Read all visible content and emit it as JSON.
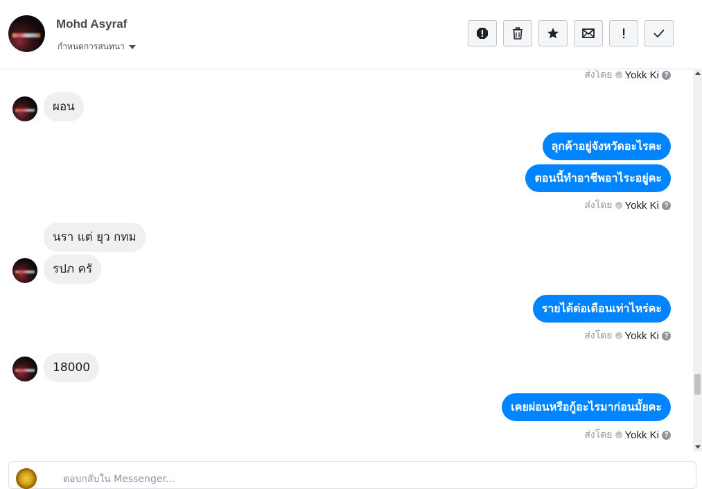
{
  "header": {
    "name": "Mohd Asyraf",
    "subtitle": "กำหนดการสนทนา"
  },
  "toolbar": {
    "buttons": [
      {
        "icon": "alert-octagon-icon"
      },
      {
        "icon": "trash-icon"
      },
      {
        "icon": "star-icon"
      },
      {
        "icon": "envelope-icon"
      },
      {
        "icon": "exclamation-icon"
      },
      {
        "icon": "checkmark-icon"
      }
    ]
  },
  "sent_by": {
    "label": "ส่งโดย",
    "name": "Yokk Ki",
    "help": "?"
  },
  "messages": [
    {
      "dir": "in",
      "text": "ผอน"
    },
    {
      "dir": "out",
      "text": "ลุกค้าอยู่จังหวัดอะไรคะ"
    },
    {
      "dir": "out",
      "text": "ตอนนี้ทำอาชีพอาไระอยู่คะ"
    },
    {
      "dir": "in",
      "text": "นรา แต่ ยุว กทม"
    },
    {
      "dir": "in",
      "text": "รปภ ครั"
    },
    {
      "dir": "out",
      "text": "รายได้ต่อเดือนเท่าไหร่คะ"
    },
    {
      "dir": "in",
      "text": "18000"
    },
    {
      "dir": "out",
      "text": "เคยผ่อนหรือกู้อะไรมาก่อนมั้ยคะ"
    }
  ],
  "composer": {
    "placeholder": "ตอบกลับใน Messenger..."
  },
  "colors": {
    "outgoing_bubble": "#0084ff",
    "incoming_bubble": "#f1f0f0",
    "meta_text": "#90949c"
  }
}
